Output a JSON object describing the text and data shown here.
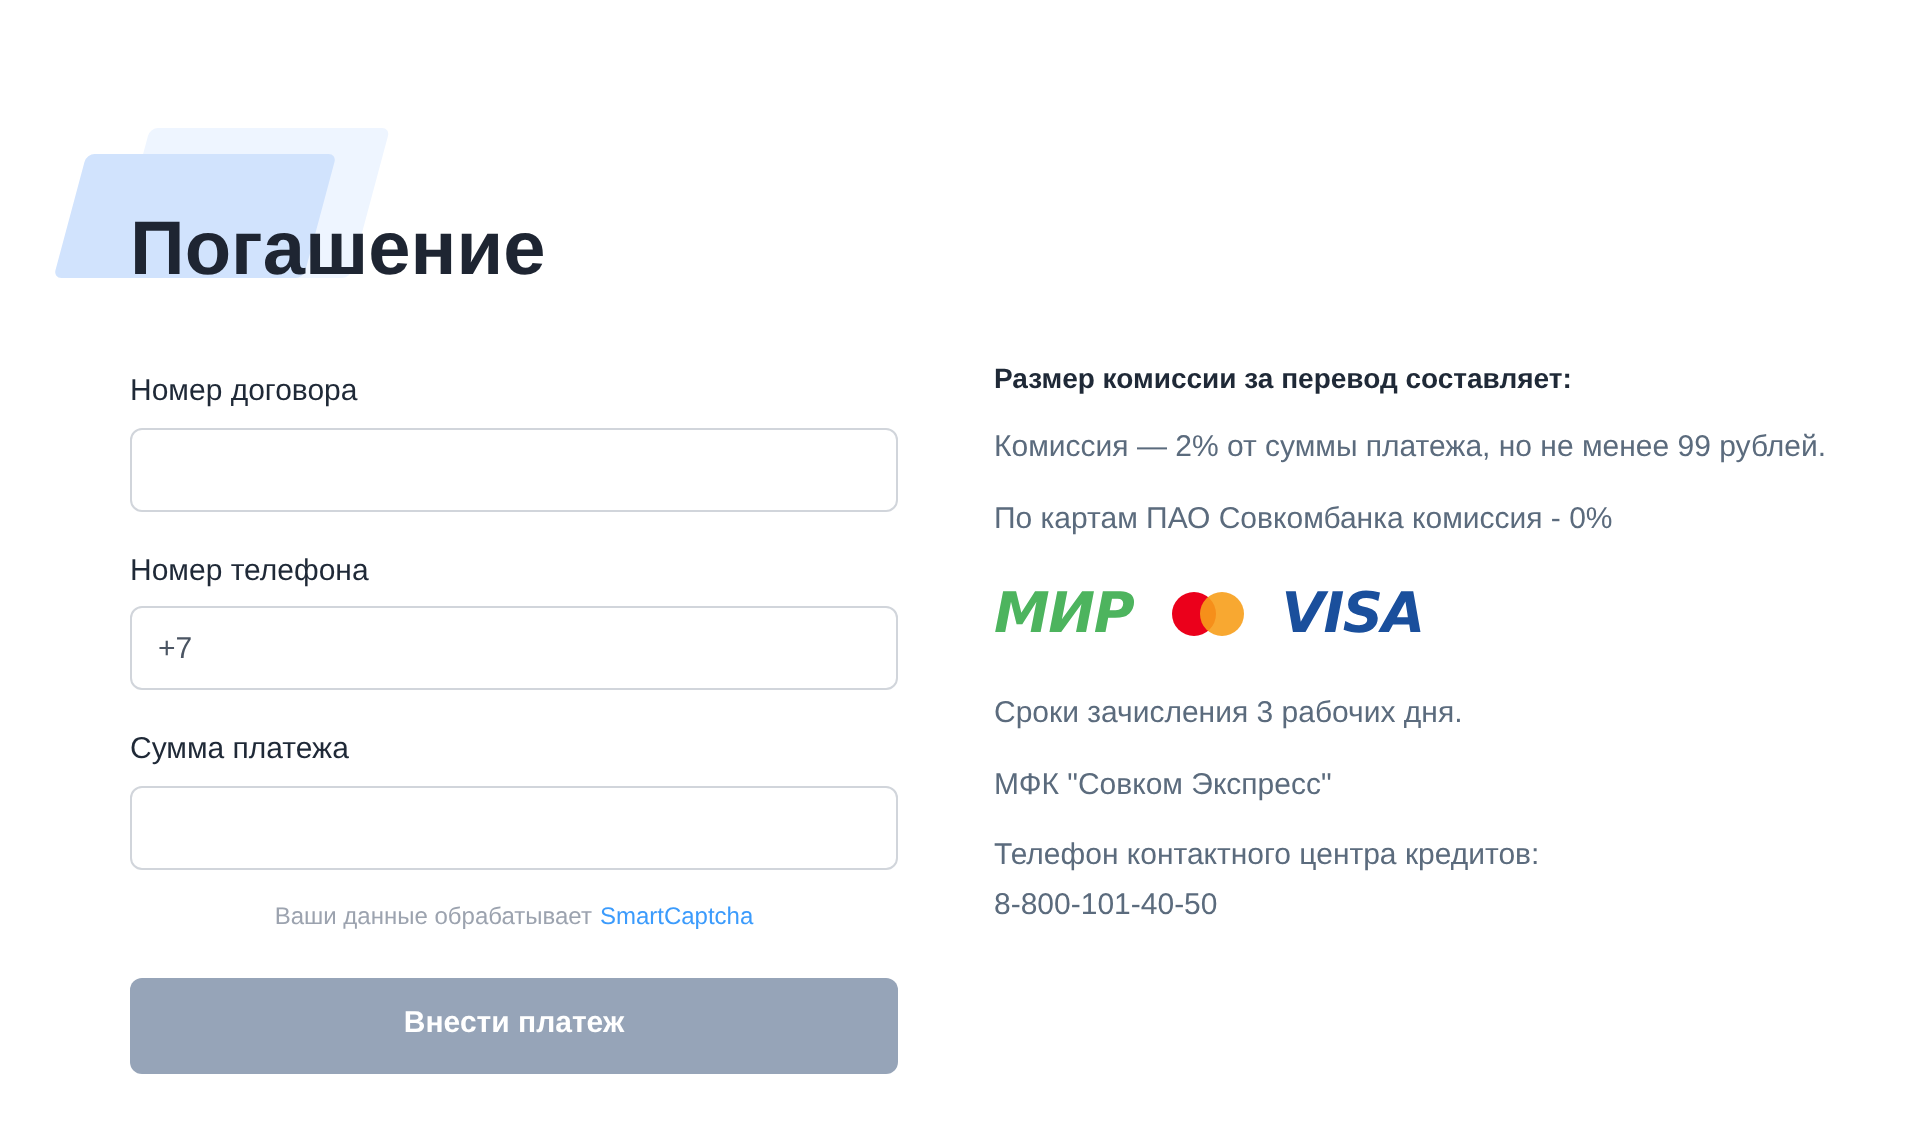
{
  "title": "Погашение",
  "fields": [
    {
      "label": "Номер договора"
    },
    {
      "label": "Номер телефона",
      "value": "+7"
    },
    {
      "label": "Сумма платежа"
    }
  ],
  "captcha": {
    "text": "Ваши данные обрабатывает",
    "link": "SmartCaptcha"
  },
  "submit": {
    "label": "Внести платеж",
    "disabled": true
  },
  "info": {
    "heading": "Размер комиссии за перевод составляет:",
    "lines": [
      "Комиссия — 2% от суммы платежа, но не менее 99 рублей.",
      "По картам ПАО Совкомбанка комиссия - 0%"
    ],
    "cards": [
      {
        "kind": "mir",
        "label": "МИР"
      },
      {
        "kind": "mastercard"
      },
      {
        "kind": "visa",
        "label": "VISA"
      }
    ],
    "details": [
      "Сроки зачисления 3 рабочих дня.",
      "МФК \"Совком Экспресс\""
    ],
    "phone_label": "Телефон контактного центра кредитов:",
    "phone": "8-800-101-40-50"
  }
}
